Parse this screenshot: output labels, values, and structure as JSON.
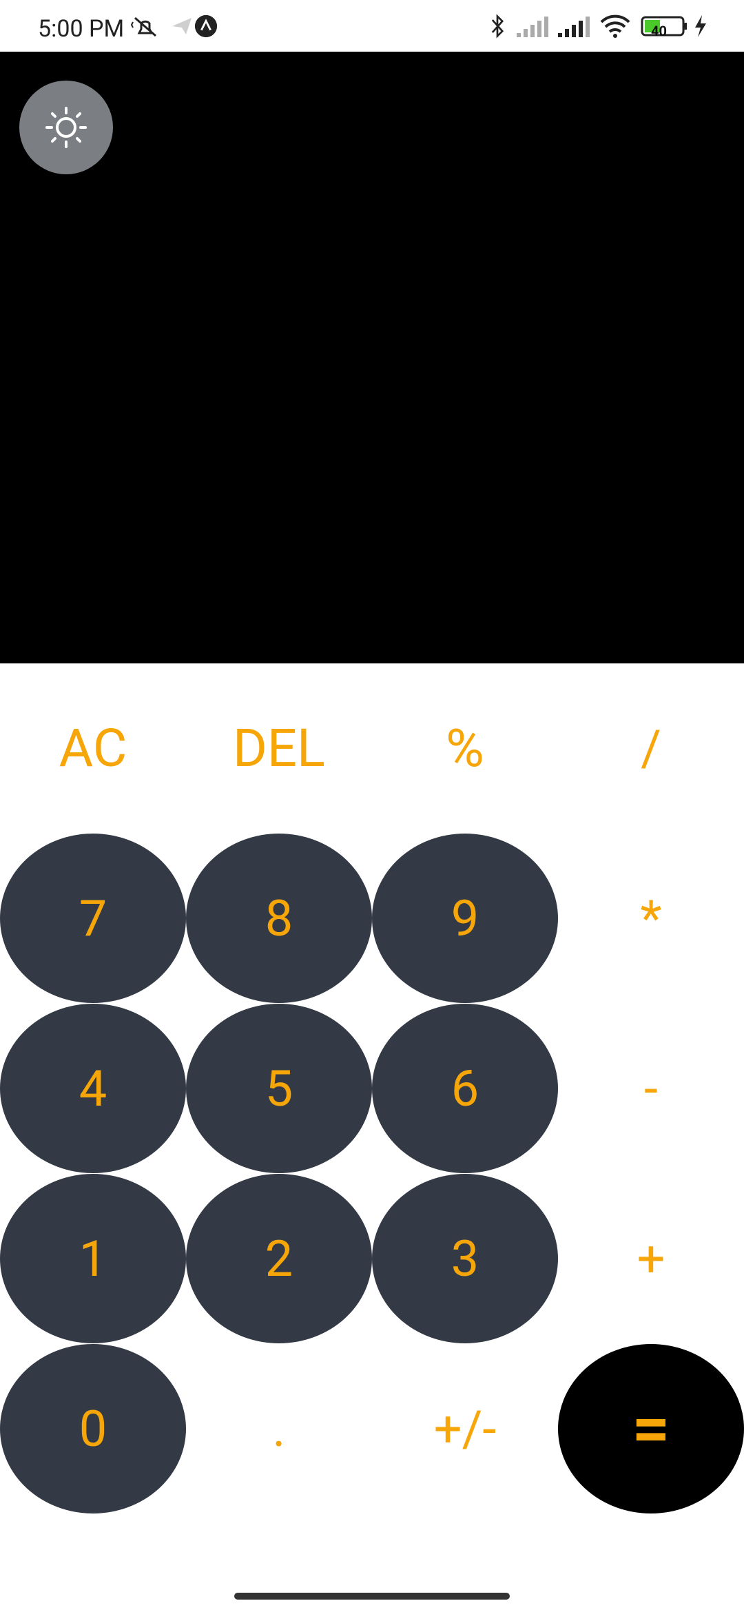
{
  "status_bar": {
    "time": "5:00 PM",
    "battery_level": "40"
  },
  "display": {
    "result": ""
  },
  "keypad": {
    "row1": [
      "AC",
      "DEL",
      "%",
      "/"
    ],
    "row2": [
      "7",
      "8",
      "9",
      "*"
    ],
    "row3": [
      "4",
      "5",
      "6",
      "-"
    ],
    "row4": [
      "1",
      "2",
      "3",
      "+"
    ],
    "row5": [
      "0",
      ".",
      "+/-",
      "="
    ]
  },
  "colors": {
    "accent": "#f6a609",
    "key_bg": "#333a45",
    "display_bg": "#000000",
    "toggle_bg": "#7b7f83"
  }
}
